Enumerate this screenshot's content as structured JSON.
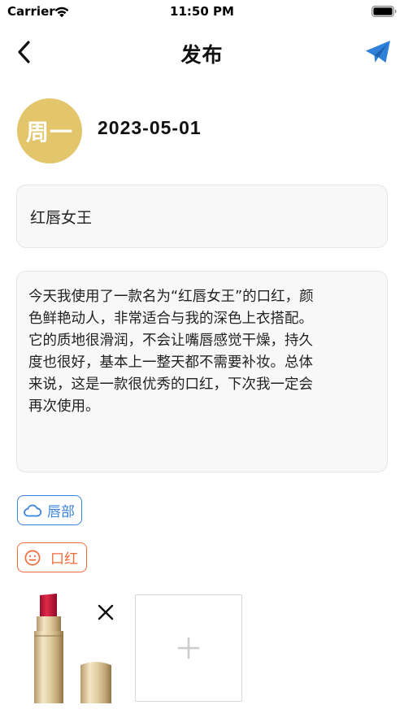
{
  "status_bar": {
    "carrier": "Carrier",
    "time": "11:50 PM",
    "icons": [
      "wifi-icon",
      "battery-icon"
    ]
  },
  "nav": {
    "title": "发布",
    "back_icon": "chevron-left-icon",
    "send_icon": "paper-plane-icon",
    "accent_color": "#2f80d8"
  },
  "entry": {
    "weekday": "周一",
    "weekday_badge_color": "#e3c56c",
    "date": "2023-05-01"
  },
  "form": {
    "title_value": "红唇女王",
    "content_lines": [
      "今天我使用了一款名为“红唇女王”的口红，颜",
      "色鲜艳动人，非常适合与我的深色上衣搭配。",
      "它的质地很滑润，不会让嘴唇感觉干燥，持久",
      "度也很好，基本上一整天都不需要补妆。总体",
      "来说，这是一款很优秀的口红，下次我一定会",
      "再次使用。"
    ]
  },
  "tags": [
    {
      "label": "唇部",
      "icon": "cloud-icon",
      "color": "#3a82e0"
    },
    {
      "label": "口红",
      "icon": "smiley-face-icon",
      "color": "#f06a3a"
    }
  ],
  "images": {
    "photo_icon": "lipstick-photo",
    "remove_icon": "close-icon",
    "add_icon": "plus-icon"
  }
}
